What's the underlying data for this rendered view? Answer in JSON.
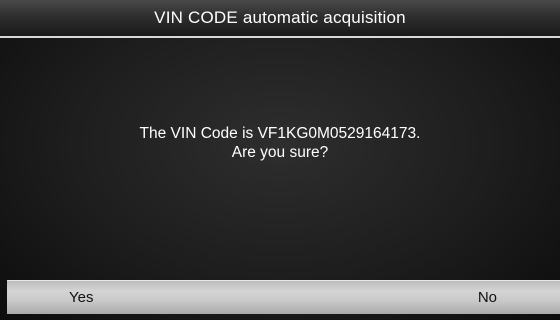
{
  "header": {
    "title": "VIN CODE automatic  acquisition"
  },
  "dialog": {
    "message_line1": "The VIN Code is VF1KG0M0529164173.",
    "message_line2": "Are you sure?"
  },
  "buttons": {
    "yes_label": "Yes",
    "no_label": "No"
  },
  "colors": {
    "background": "#1d1d1d",
    "title_text": "#ffffff",
    "divider": "#d8d8d8",
    "button_bar": "#c9c9c9",
    "button_text": "#111111"
  }
}
